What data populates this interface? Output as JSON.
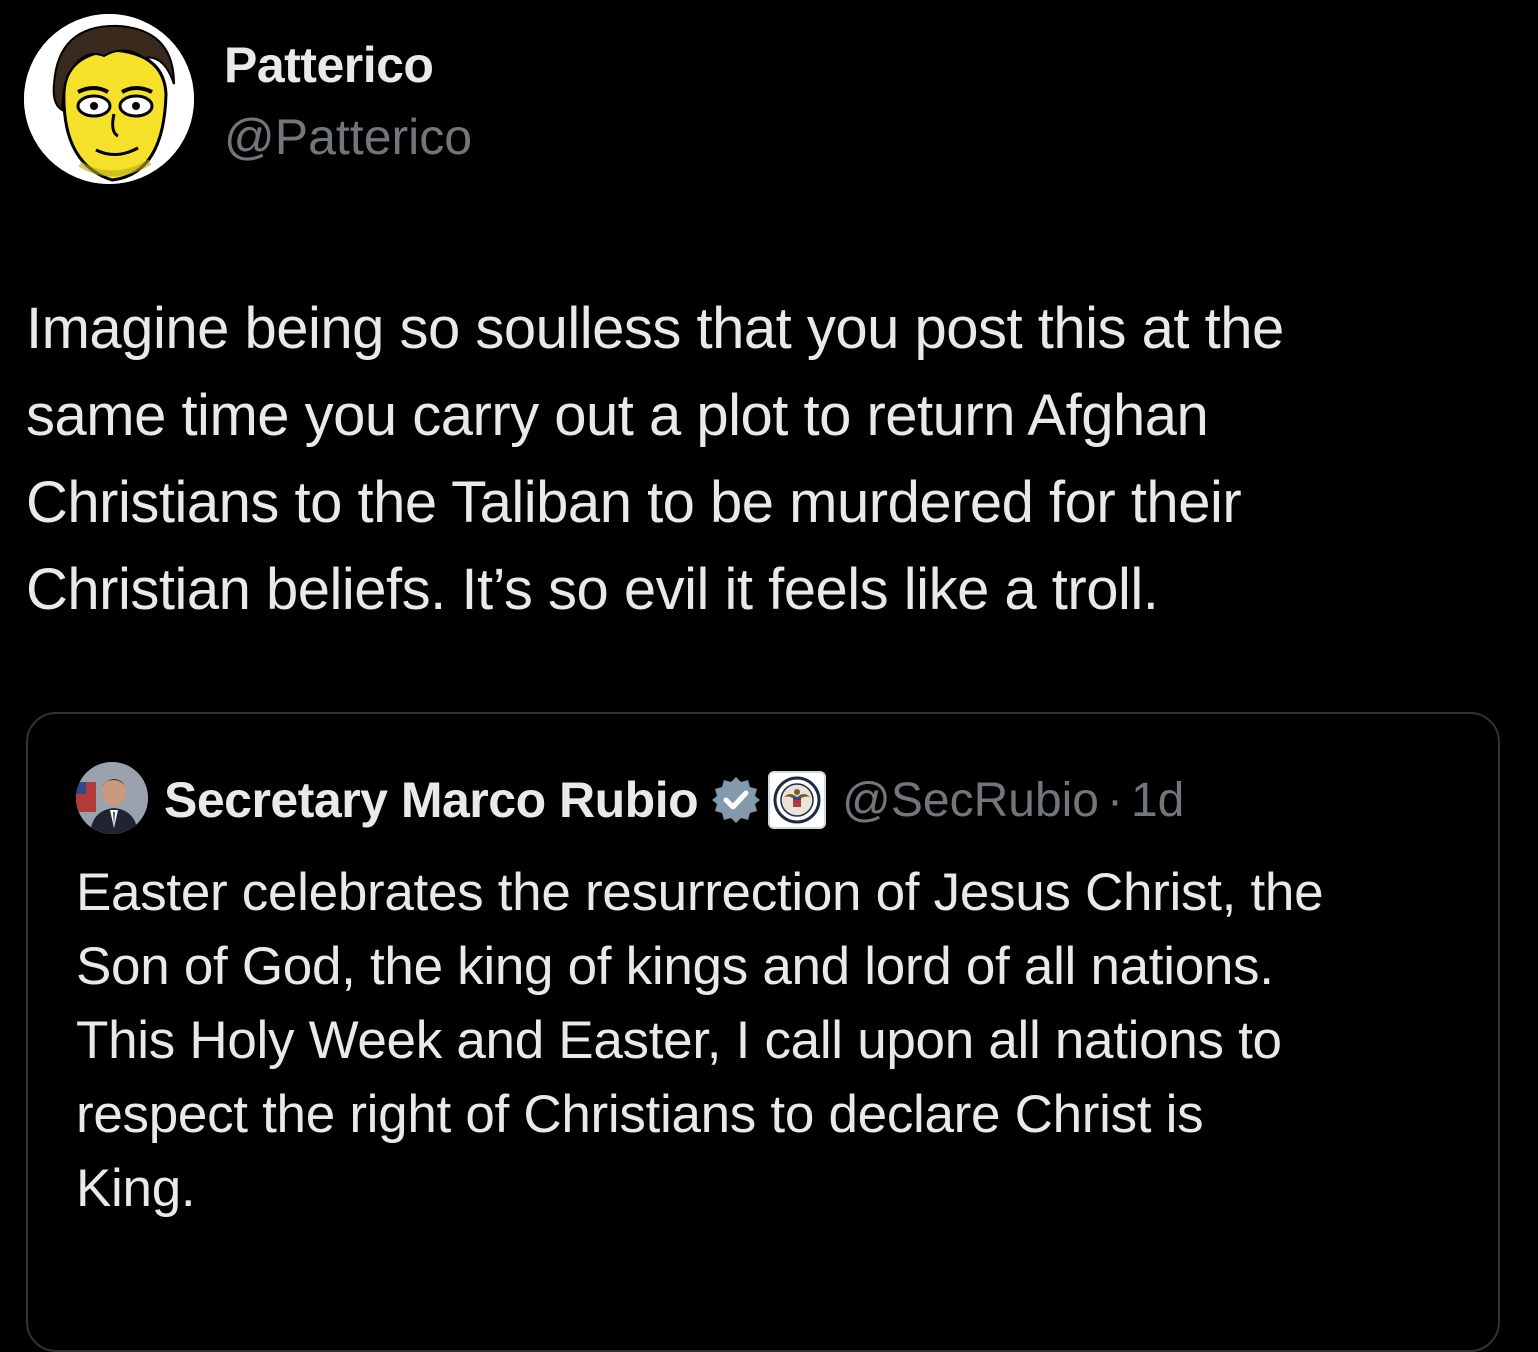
{
  "author": {
    "display_name": "Patterico",
    "handle": "@Patterico",
    "avatar_icon": "cartoon-face-avatar"
  },
  "tweet": {
    "text": "Imagine being so soulless that you post this at the\nsame time you carry out a plot to return Afghan\nChristians to the Taliban to be murdered for their\nChristian beliefs. It’s so evil it feels like a troll."
  },
  "quoted_tweet": {
    "display_name": "Secretary Marco Rubio",
    "handle": "@SecRubio",
    "separator": "·",
    "time": "1d",
    "verified_icon": "verified-badge-icon",
    "affiliation_icon": "state-department-seal-icon",
    "text": "Easter celebrates the resurrection of Jesus Christ, the\nSon of God, the king of kings and lord of all nations.\nThis Holy Week and Easter, I call upon all nations to\nrespect the right of Christians to declare Christ is\nKing."
  },
  "colors": {
    "background": "#000000",
    "primary_text": "#e7e9ea",
    "secondary_text": "#71767b",
    "border": "#2f3336",
    "verified_badge": "#829aab",
    "avatar_face": "#f5e12a"
  }
}
